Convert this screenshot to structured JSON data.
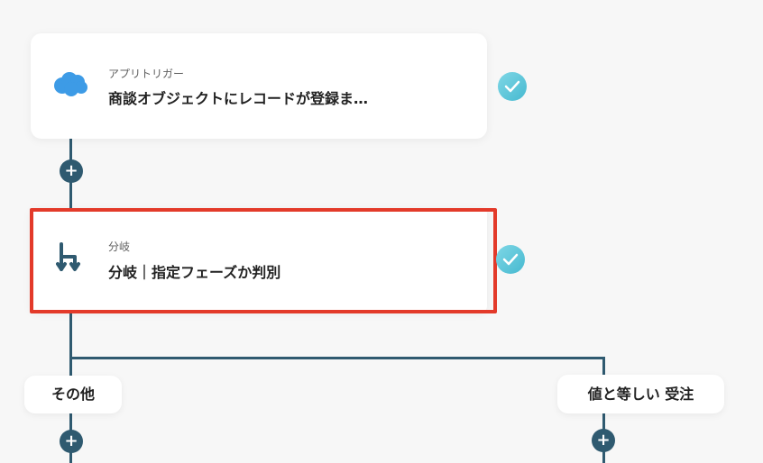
{
  "steps": [
    {
      "subtitle": "アプリトリガー",
      "title": "商談オブジェクトにレコードが登録ま…",
      "icon": "salesforce-cloud-icon"
    },
    {
      "subtitle": "分岐",
      "title": "分岐｜指定フェーズか判別",
      "icon": "branch-icon"
    }
  ],
  "branches": {
    "left": "その他",
    "right": "値と等しい 受注"
  },
  "colors": {
    "line": "#2f5a70",
    "highlight": "#e33a2a",
    "check": "#4fc0d4",
    "salesforce": "#3d9be6"
  }
}
